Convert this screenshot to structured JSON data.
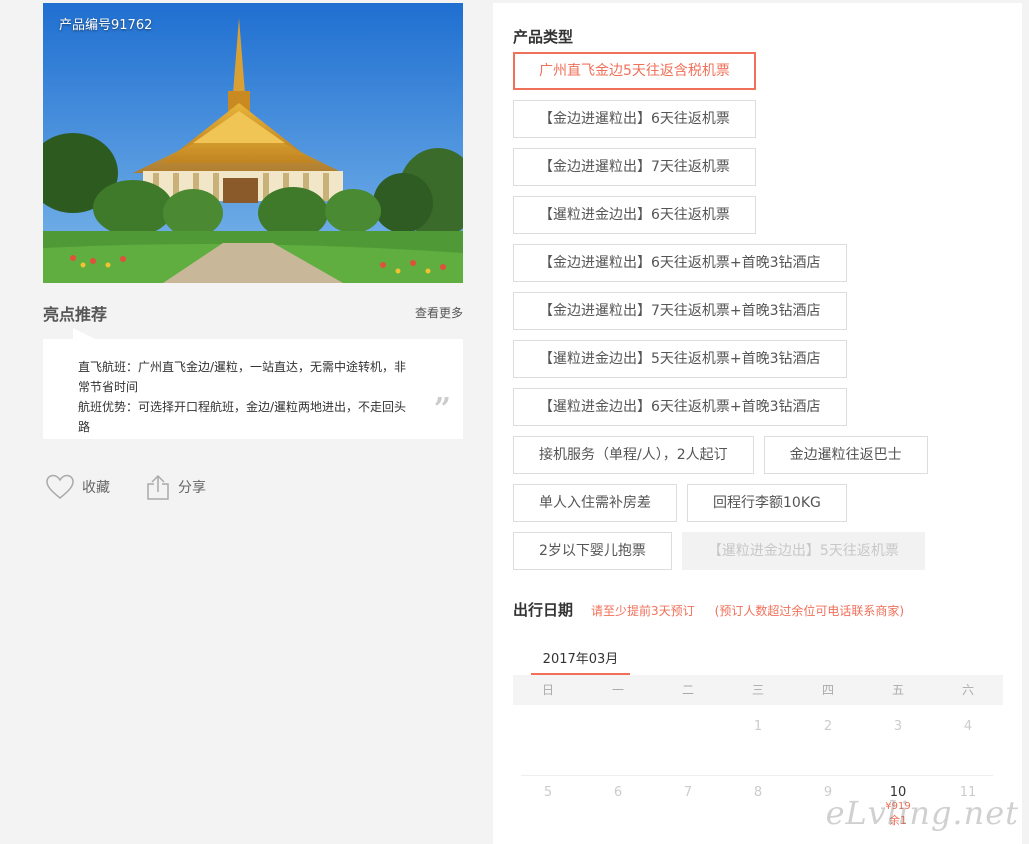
{
  "product": {
    "number_label": "产品编号91762"
  },
  "highlights": {
    "title": "亮点推荐",
    "more": "查看更多",
    "line1": "直飞航班：广州直飞金边/暹粒，一站直达，无需中途转机，非常节省时间",
    "line2": "航班优势：可选择开口程航班，金边/暹粒两地进出，不走回头路",
    "quote": "”"
  },
  "actions": {
    "favorite": "收藏",
    "share": "分享"
  },
  "product_types": {
    "title": "产品类型",
    "options": [
      {
        "label": "广州直飞金边5天往返含税机票",
        "state": "selected"
      },
      {
        "label": "【金边进暹粒出】6天往返机票",
        "state": "normal"
      },
      {
        "label": "【金边进暹粒出】7天往返机票",
        "state": "normal"
      },
      {
        "label": "【暹粒进金边出】6天往返机票",
        "state": "normal"
      },
      {
        "label": "【金边进暹粒出】6天往返机票+首晚3钻酒店",
        "state": "normal"
      },
      {
        "label": "【金边进暹粒出】7天往返机票+首晚3钻酒店",
        "state": "normal"
      },
      {
        "label": "【暹粒进金边出】5天往返机票+首晚3钻酒店",
        "state": "normal"
      },
      {
        "label": "【暹粒进金边出】6天往返机票+首晚3钻酒店",
        "state": "normal"
      },
      {
        "label": "接机服务（单程/人），2人起订",
        "state": "normal"
      },
      {
        "label": "金边暹粒往返巴士",
        "state": "normal"
      },
      {
        "label": "单人入住需补房差",
        "state": "normal"
      },
      {
        "label": "回程行李额10KG",
        "state": "normal"
      },
      {
        "label": "2岁以下婴儿抱票",
        "state": "normal"
      },
      {
        "label": "【暹粒进金边出】5天往返机票",
        "state": "disabled"
      }
    ]
  },
  "travel_date": {
    "title": "出行日期",
    "note1": "请至少提前3天预订",
    "note2": "(预订人数超过余位可电话联系商家)",
    "month": "2017年03月",
    "weekdays": [
      "日",
      "一",
      "二",
      "三",
      "四",
      "五",
      "六"
    ],
    "row1": [
      "",
      "",
      "",
      "1",
      "2",
      "3",
      "4"
    ],
    "row2": [
      "5",
      "6",
      "7",
      "8",
      "9",
      "10",
      "11"
    ],
    "avail_day": "10",
    "avail_price": "¥919",
    "avail_remain": "余1"
  },
  "watermark": "eLvling.net",
  "colors": {
    "accent": "#f0705a",
    "panel_bg": "#ffffff",
    "page_bg": "#f3f3f3"
  }
}
